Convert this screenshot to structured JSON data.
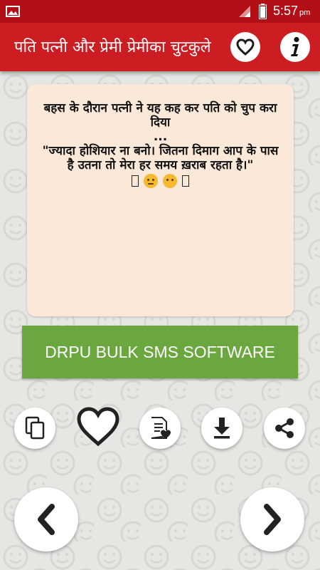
{
  "status_bar": {
    "time": "5:57",
    "ampm": "pm"
  },
  "app_bar": {
    "title": "पति पत्नी और प्रेमी प्रेमीका चुटकुले"
  },
  "message": {
    "text": "बहस के दौरान पत्नी ने यह कह कर पति को चुप करा दिया\n...\n\"ज्यादा होशियार ना बनो। जितना दिमाग आप के पास है उतना तो मेरा हर समय ख़राब रहता है।\""
  },
  "banner": {
    "label": "DRPU BULK SMS SOFTWARE"
  },
  "actions": [
    "copy-icon",
    "heart-icon",
    "favorite-list-icon",
    "download-icon",
    "share-icon"
  ],
  "navigation": [
    "chevron-left-icon",
    "chevron-right-icon"
  ],
  "colors": {
    "status_bar": "#b30f16",
    "app_bar": "#cc1d23",
    "card": "#fae8d9",
    "banner": "#6aa83f"
  }
}
